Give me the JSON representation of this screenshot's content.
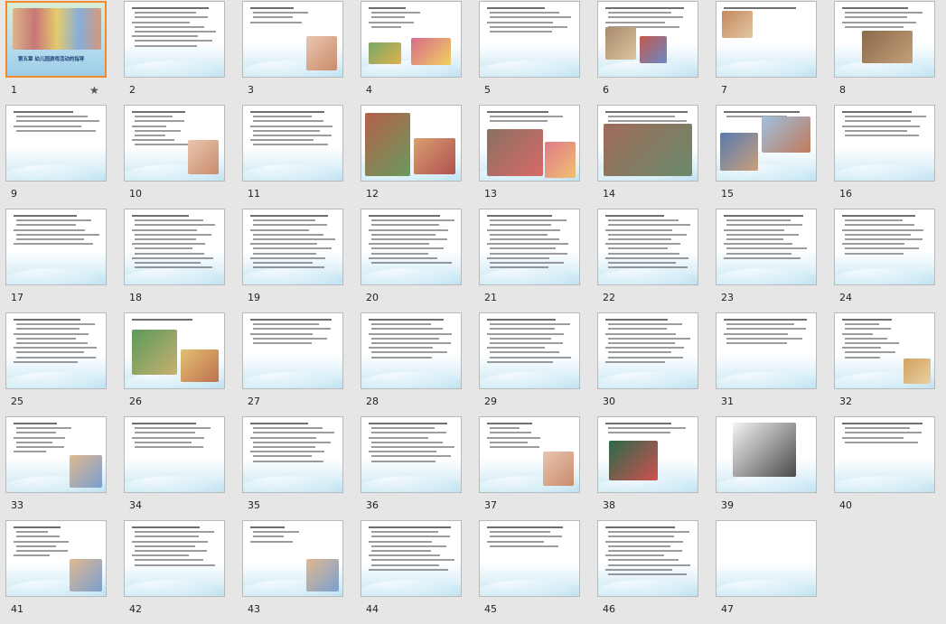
{
  "view": "slide-sorter",
  "columns": 8,
  "slides": [
    {
      "number": "1",
      "selected": true,
      "title": "第五章 幼儿园游戏活动的指导",
      "style": "cover",
      "lines": 0,
      "pics": []
    },
    {
      "number": "2",
      "lines": 9,
      "pics": []
    },
    {
      "number": "3",
      "lines": 4,
      "pics": [
        "portrait"
      ]
    },
    {
      "number": "4",
      "lines": 5,
      "pics": [
        "green",
        "toys"
      ]
    },
    {
      "number": "5",
      "lines": 6,
      "pics": []
    },
    {
      "number": "6",
      "lines": 5,
      "pics": [
        "room",
        "kids"
      ]
    },
    {
      "number": "7",
      "lines": 1,
      "pics": [
        "pair"
      ]
    },
    {
      "number": "8",
      "lines": 5,
      "pics": [
        "class"
      ]
    },
    {
      "number": "9",
      "lines": 5,
      "pics": []
    },
    {
      "number": "10",
      "lines": 8,
      "pics": [
        "portrait"
      ]
    },
    {
      "number": "11",
      "lines": 8,
      "pics": []
    },
    {
      "number": "12",
      "lines": 0,
      "pics": [
        "collage"
      ]
    },
    {
      "number": "13",
      "lines": 3,
      "pics": [
        "two"
      ]
    },
    {
      "number": "14",
      "lines": 3,
      "pics": [
        "grid"
      ]
    },
    {
      "number": "15",
      "lines": 2,
      "pics": [
        "grid2"
      ]
    },
    {
      "number": "16",
      "lines": 6,
      "pics": []
    },
    {
      "number": "17",
      "lines": 7,
      "pics": []
    },
    {
      "number": "18",
      "lines": 12,
      "pics": []
    },
    {
      "number": "19",
      "lines": 12,
      "pics": []
    },
    {
      "number": "20",
      "lines": 11,
      "pics": []
    },
    {
      "number": "21",
      "lines": 12,
      "pics": []
    },
    {
      "number": "22",
      "lines": 12,
      "pics": []
    },
    {
      "number": "23",
      "lines": 10,
      "pics": []
    },
    {
      "number": "24",
      "lines": 9,
      "pics": []
    },
    {
      "number": "25",
      "lines": 10,
      "pics": []
    },
    {
      "number": "26",
      "lines": 1,
      "pics": [
        "play"
      ]
    },
    {
      "number": "27",
      "lines": 6,
      "pics": []
    },
    {
      "number": "28",
      "lines": 9,
      "pics": []
    },
    {
      "number": "29",
      "lines": 10,
      "pics": []
    },
    {
      "number": "30",
      "lines": 10,
      "pics": []
    },
    {
      "number": "31",
      "lines": 6,
      "pics": []
    },
    {
      "number": "32",
      "lines": 9,
      "pics": [
        "kid"
      ]
    },
    {
      "number": "33",
      "lines": 7,
      "pics": [
        "kidsq"
      ]
    },
    {
      "number": "34",
      "lines": 6,
      "pics": []
    },
    {
      "number": "35",
      "lines": 9,
      "pics": []
    },
    {
      "number": "36",
      "lines": 9,
      "pics": []
    },
    {
      "number": "37",
      "lines": 6,
      "pics": [
        "portrait"
      ]
    },
    {
      "number": "38",
      "lines": 3,
      "pics": [
        "board"
      ]
    },
    {
      "number": "39",
      "lines": 0,
      "pics": [
        "chalk"
      ]
    },
    {
      "number": "40",
      "lines": 5,
      "pics": []
    },
    {
      "number": "41",
      "lines": 7,
      "pics": [
        "kidsq"
      ]
    },
    {
      "number": "42",
      "lines": 9,
      "pics": []
    },
    {
      "number": "43",
      "lines": 4,
      "pics": [
        "kidsq"
      ]
    },
    {
      "number": "44",
      "lines": 10,
      "pics": []
    },
    {
      "number": "45",
      "lines": 5,
      "pics": []
    },
    {
      "number": "46",
      "lines": 11,
      "pics": []
    },
    {
      "number": "47",
      "lines": 0,
      "pics": []
    }
  ],
  "colors": {
    "selection": "#f08a2c",
    "background": "#e6e6e6"
  }
}
